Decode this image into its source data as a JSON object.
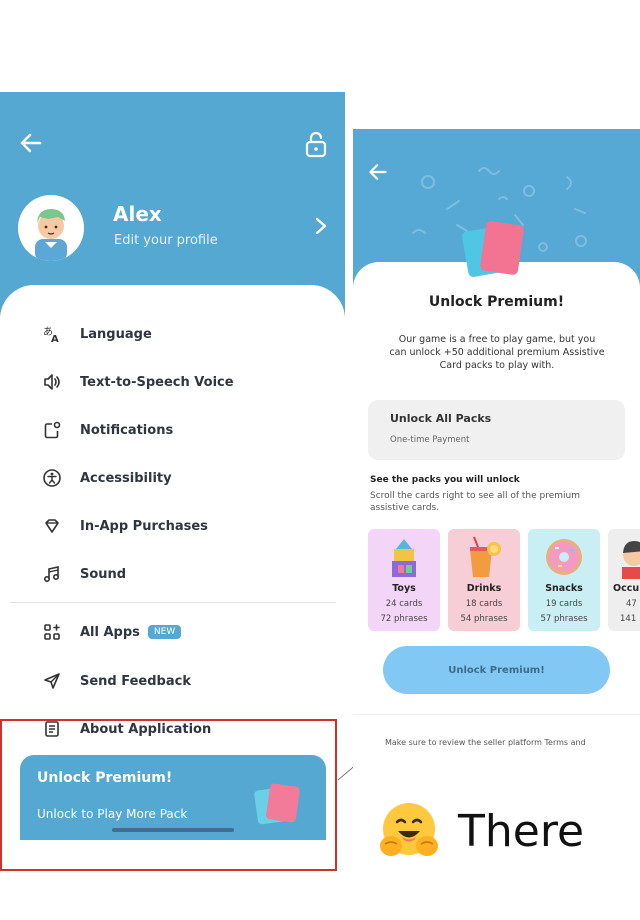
{
  "left_screen": {
    "profile": {
      "name": "Alex",
      "subtitle": "Edit your profile"
    },
    "menu": [
      {
        "label": "Language",
        "icon": "translate-icon"
      },
      {
        "label": "Text-to-Speech Voice",
        "icon": "speaker-icon"
      },
      {
        "label": "Notifications",
        "icon": "notification-icon"
      },
      {
        "label": "Accessibility",
        "icon": "accessibility-icon"
      },
      {
        "label": "In-App Purchases",
        "icon": "diamond-icon"
      },
      {
        "label": "Sound",
        "icon": "music-note-icon"
      },
      {
        "label": "All Apps",
        "icon": "apps-grid-icon",
        "badge": "NEW"
      },
      {
        "label": "Send Feedback",
        "icon": "send-icon"
      },
      {
        "label": "About Application",
        "icon": "document-icon"
      }
    ],
    "promo": {
      "title": "Unlock Premium!",
      "subtitle": "Unlock to Play More Pack"
    }
  },
  "right_screen": {
    "title": "Unlock Premium!",
    "description": "Our game is a free to play game, but you can unlock +50 additional premium Assistive Card packs to play with.",
    "pack_option": {
      "title": "Unlock All Packs",
      "subtitle": "One-time Payment"
    },
    "see_title": "See the packs you will unlock",
    "see_subtitle": "Scroll the cards right to see all of the premium assistive cards.",
    "cards": [
      {
        "name": "Toys",
        "cards": "24 cards",
        "phrases": "72 phrases",
        "color": "#f3d6f7"
      },
      {
        "name": "Drinks",
        "cards": "18 cards",
        "phrases": "54 phrases",
        "color": "#f7cdd6"
      },
      {
        "name": "Snacks",
        "cards": "19 cards",
        "phrases": "57 phrases",
        "color": "#c9eef4"
      },
      {
        "name": "Occu",
        "cards": "47",
        "phrases": "141",
        "color": "#eeeeee"
      }
    ],
    "button": "Unlock Premium!",
    "footer": "Make sure to review the seller platform Terms and"
  },
  "caption": {
    "text": "There",
    "icon": "hugging-face-emoji"
  },
  "colors": {
    "header_blue": "#55a8d2",
    "highlight_red": "#d32f2f",
    "button_blue": "#82c8f5"
  }
}
